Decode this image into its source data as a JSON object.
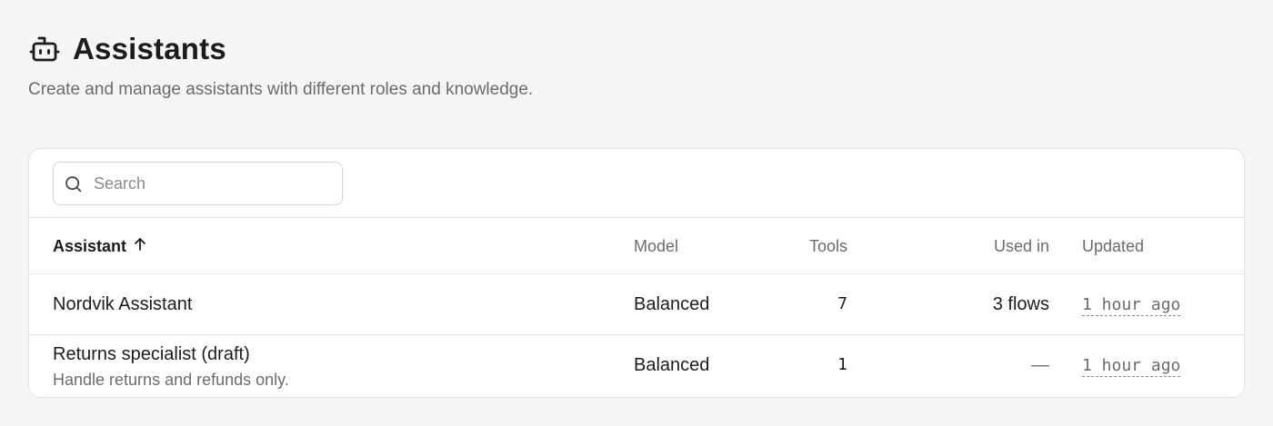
{
  "header": {
    "title": "Assistants",
    "icon": "robot-icon",
    "subtitle": "Create and manage assistants with different roles and knowledge."
  },
  "search": {
    "placeholder": "Search",
    "value": ""
  },
  "table": {
    "columns": {
      "assistant": "Assistant",
      "sort_indicator": "arrow-up-icon",
      "model": "Model",
      "tools": "Tools",
      "used_in": "Used in",
      "updated": "Updated"
    },
    "rows": [
      {
        "name": "Nordvik Assistant",
        "description": "",
        "model": "Balanced",
        "tools": "7",
        "used_in": "3 flows",
        "updated": "1 hour ago"
      },
      {
        "name": "Returns specialist (draft)",
        "description": "Handle returns and refunds only.",
        "model": "Balanced",
        "tools": "1",
        "used_in": "—",
        "updated": "1 hour ago"
      }
    ]
  },
  "colors": {
    "background": "#f5f5f5",
    "card": "#ffffff",
    "text_primary": "#1c1c1e",
    "text_muted": "#6b6b70",
    "border": "#e4e4e7"
  }
}
